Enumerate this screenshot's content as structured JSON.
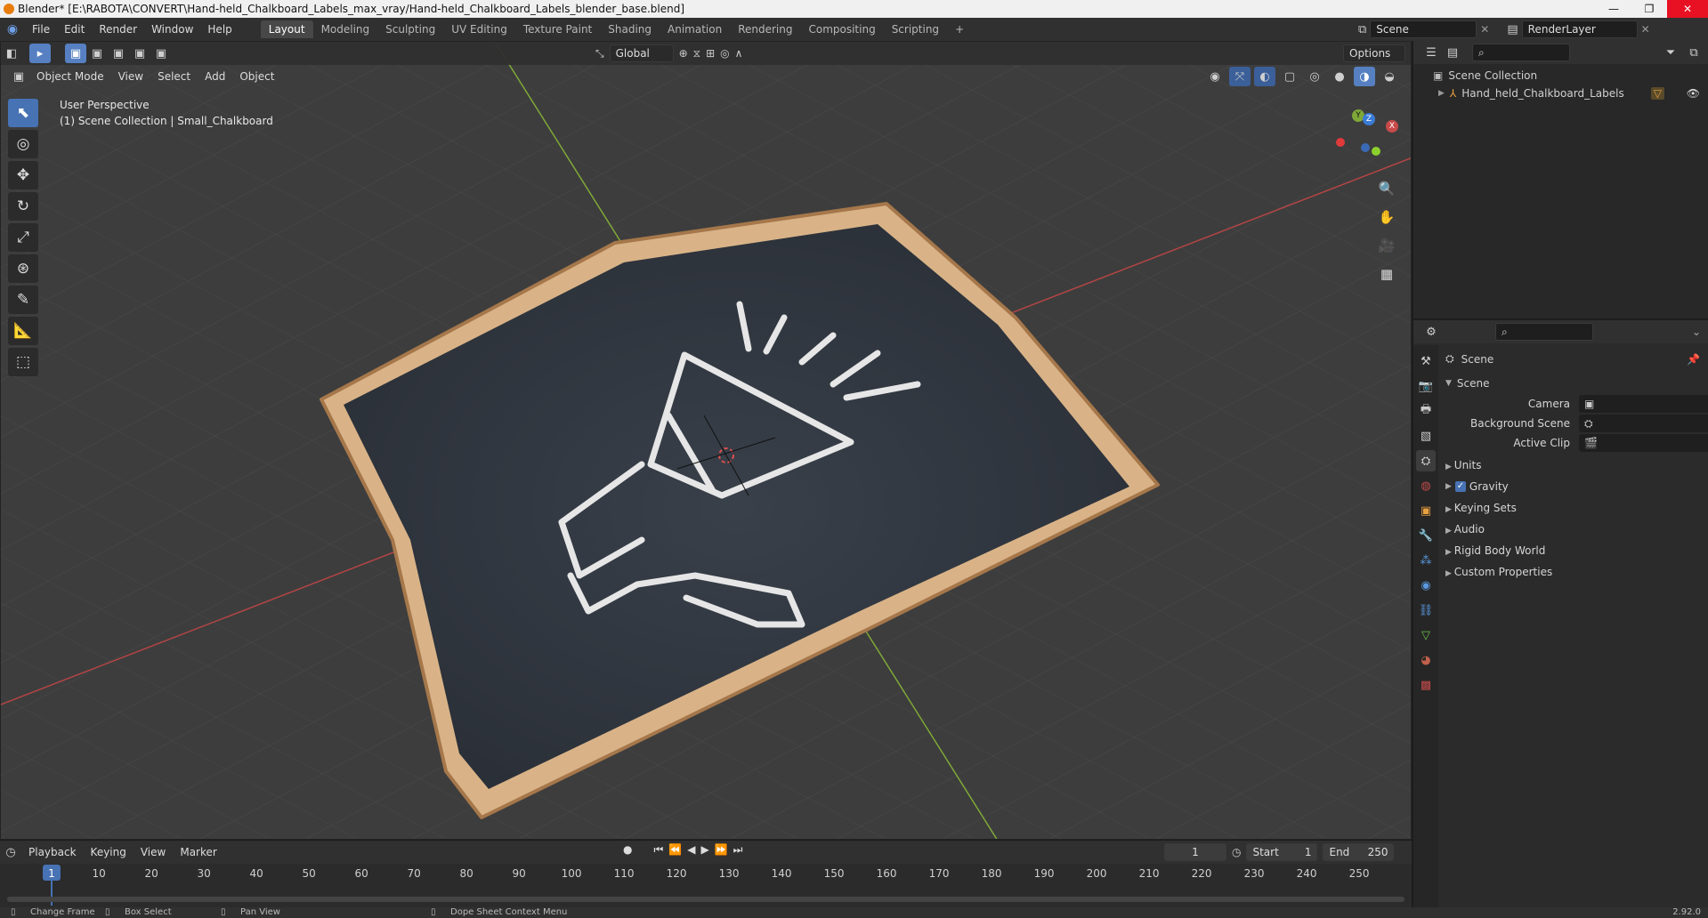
{
  "titlebar": {
    "title": "Blender* [E:\\RABOTA\\CONVERT\\Hand-held_Chalkboard_Labels_max_vray/Hand-held_Chalkboard_Labels_blender_base.blend]",
    "minimize": "—",
    "maximize": "❐",
    "close": "✕"
  },
  "menu": [
    "File",
    "Edit",
    "Render",
    "Window",
    "Help"
  ],
  "workspaces": [
    "Layout",
    "Modeling",
    "Sculpting",
    "UV Editing",
    "Texture Paint",
    "Shading",
    "Animation",
    "Rendering",
    "Compositing",
    "Scripting"
  ],
  "workspace_add": "+",
  "scene_field": "Scene",
  "render_layer_field": "RenderLayer",
  "viewport": {
    "mode": "Object Mode",
    "menus": [
      "View",
      "Select",
      "Add",
      "Object"
    ],
    "transform_orientation": "Global",
    "options": "Options",
    "info_line1": "User Perspective",
    "info_line2": "(1) Scene Collection | Small_Chalkboard",
    "gizmo": {
      "x": "X",
      "y": "Y",
      "z": "Z"
    }
  },
  "outliner": {
    "root": "Scene Collection",
    "items": [
      "Hand_held_Chalkboard_Labels"
    ]
  },
  "properties": {
    "context": "Scene",
    "panel_title": "Scene",
    "fields": [
      {
        "label": "Camera",
        "value": ""
      },
      {
        "label": "Background Scene",
        "value": ""
      },
      {
        "label": "Active Clip",
        "value": ""
      }
    ],
    "sections": [
      "Units",
      "Gravity",
      "Keying Sets",
      "Audio",
      "Rigid Body World",
      "Custom Properties"
    ]
  },
  "timeline": {
    "menus": [
      "Playback",
      "Keying",
      "View",
      "Marker"
    ],
    "current_frame": "1",
    "start_label": "Start",
    "start": "1",
    "end_label": "End",
    "end": "250",
    "ticks": [
      "1",
      "10",
      "20",
      "30",
      "40",
      "50",
      "60",
      "70",
      "80",
      "90",
      "100",
      "110",
      "120",
      "130",
      "140",
      "150",
      "160",
      "170",
      "180",
      "190",
      "200",
      "210",
      "220",
      "230",
      "240",
      "250"
    ]
  },
  "statusbar": {
    "items": [
      "Change Frame",
      "Box Select",
      "Pan View",
      "Dope Sheet Context Menu"
    ],
    "version": "2.92.0"
  },
  "colors": {
    "accent": "#4772b3",
    "x_axis": "#c84a4a",
    "y_axis": "#8ab33a",
    "z_axis": "#3a7bd5"
  }
}
